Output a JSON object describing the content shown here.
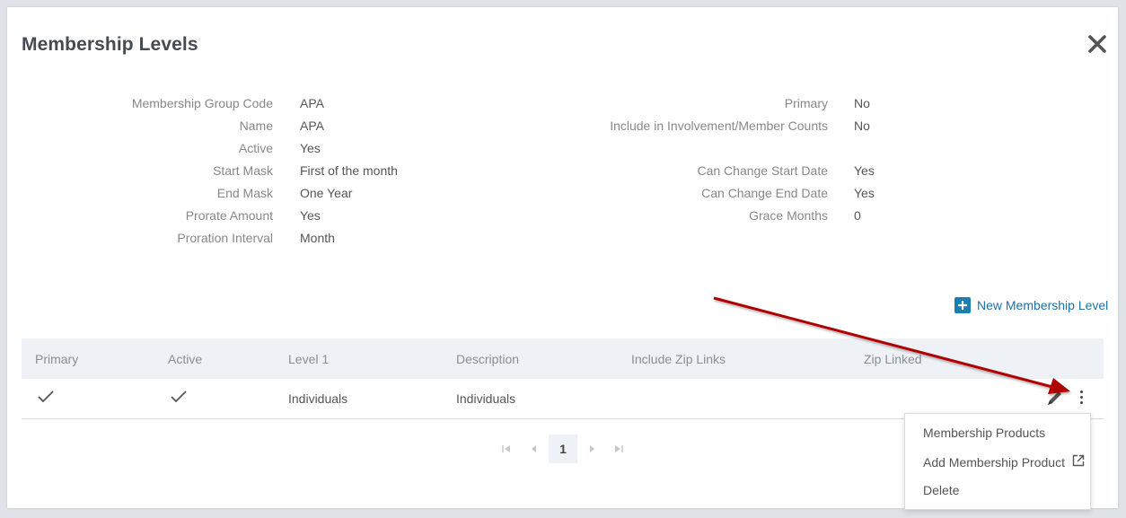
{
  "header": {
    "title": "Membership Levels",
    "close_icon": "close-icon"
  },
  "details_left": [
    {
      "label": "Membership Group Code",
      "value": "APA"
    },
    {
      "label": "Name",
      "value": "APA"
    },
    {
      "label": "Active",
      "value": "Yes"
    },
    {
      "label": "Start Mask",
      "value": "First of the month"
    },
    {
      "label": "End Mask",
      "value": "One Year"
    },
    {
      "label": "Prorate Amount",
      "value": "Yes"
    },
    {
      "label": "Proration Interval",
      "value": "Month"
    }
  ],
  "details_right": [
    {
      "label": "Primary",
      "value": "No"
    },
    {
      "label": "Include in Involvement/Member Counts",
      "value": "No"
    },
    {
      "label": "",
      "value": ""
    },
    {
      "label": "Can Change Start Date",
      "value": "Yes"
    },
    {
      "label": "Can Change End Date",
      "value": "Yes"
    },
    {
      "label": "Grace Months",
      "value": "0"
    }
  ],
  "toolbar": {
    "new_level_label": "New Membership Level",
    "new_level_icon": "plus-square-icon"
  },
  "table": {
    "columns": [
      "Primary",
      "Active",
      "Level 1",
      "Description",
      "Include Zip Links",
      "Zip Linked"
    ],
    "rows": [
      {
        "primary": "check-icon",
        "active": "check-icon",
        "level1": "Individuals",
        "description": "Individuals",
        "include_zip_links": "",
        "zip_linked": ""
      }
    ],
    "row_action_icons": [
      "pencil-icon",
      "kebab-menu-icon"
    ]
  },
  "pagination": {
    "current_page": "1",
    "icons": [
      "first-page-icon",
      "prev-page-icon",
      "next-page-icon",
      "last-page-icon"
    ]
  },
  "context_menu": {
    "items": [
      "Membership Products",
      "Add Membership Product",
      "Delete"
    ],
    "external_icon": "external-link-icon"
  },
  "colors": {
    "accent": "#1a7fb0",
    "annotation_arrow": "#b00000"
  }
}
